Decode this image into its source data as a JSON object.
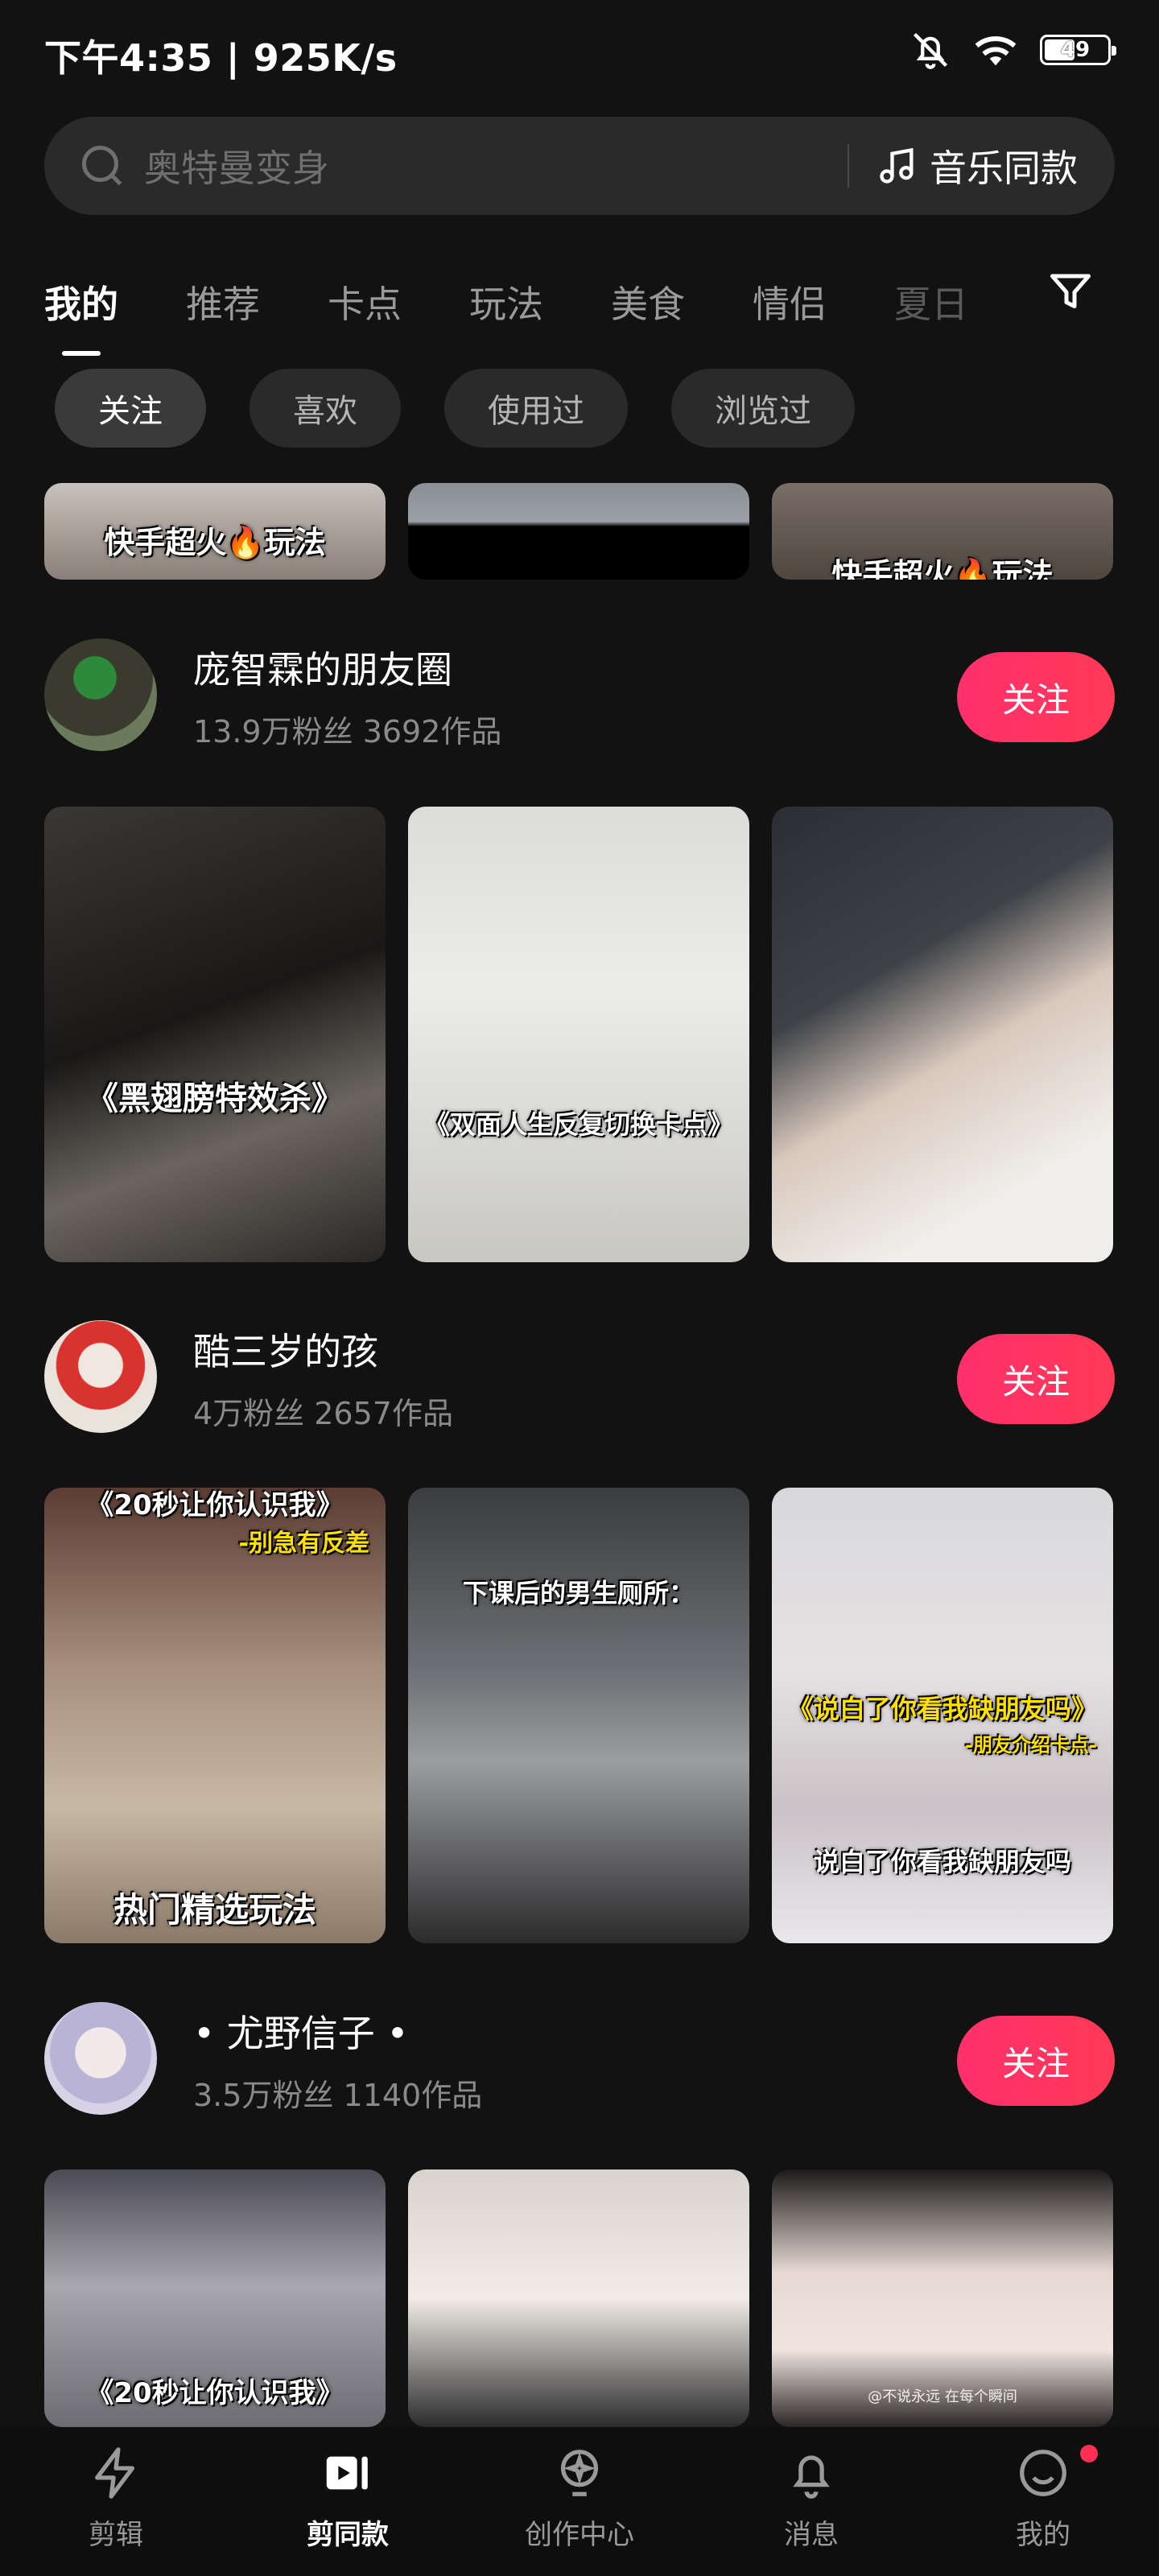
{
  "status_bar": {
    "time_speed": "下午4:35 | 925K/s",
    "battery": "49"
  },
  "search": {
    "placeholder": "奥特曼变身",
    "music_label": "音乐同款"
  },
  "tabs": [
    "我的",
    "推荐",
    "卡点",
    "玩法",
    "美食",
    "情侣",
    "夏日"
  ],
  "chips": [
    "关注",
    "喜欢",
    "使用过",
    "浏览过"
  ],
  "top_partial_row": {
    "captions": [
      "快手超火🔥玩法",
      "",
      "快手超火🔥玩法"
    ]
  },
  "creators": [
    {
      "name": "庞智霖的朋友圈",
      "stats": "13.9万粉丝  3692作品",
      "follow_label": "关注",
      "thumbs": [
        {
          "caption": "《黑翅膀特效杀》"
        },
        {
          "caption": "《双面人生反复切换卡点》"
        },
        {
          "caption": ""
        }
      ]
    },
    {
      "name": "酷三岁的孩",
      "stats": "4万粉丝  2657作品",
      "follow_label": "关注",
      "thumbs": [
        {
          "caption_top": "《20秒让你认识我》",
          "caption_sub": "-别急有反差",
          "caption": "热门精选玩法"
        },
        {
          "caption_top": "下课后的男生厕所：",
          "caption": ""
        },
        {
          "caption_top": "《说白了你看我缺朋友吗》",
          "caption_sub": "-朋友介绍卡点-",
          "caption": "说白了你看我缺朋友吗"
        }
      ]
    },
    {
      "name": "• 尤野信子 •",
      "stats": "3.5万粉丝  1140作品",
      "follow_label": "关注",
      "thumbs": [
        {
          "caption": "《20秒让你认识我》"
        },
        {
          "caption": ""
        },
        {
          "caption": "",
          "watermark": "@不说永远 在每个瞬间"
        }
      ]
    }
  ],
  "bottom_nav": [
    "剪辑",
    "剪同款",
    "创作中心",
    "消息",
    "我的"
  ],
  "colors": {
    "background": "#121212",
    "accent_pink": "#ff2f6d",
    "search_bg": "#2a2a2a"
  }
}
